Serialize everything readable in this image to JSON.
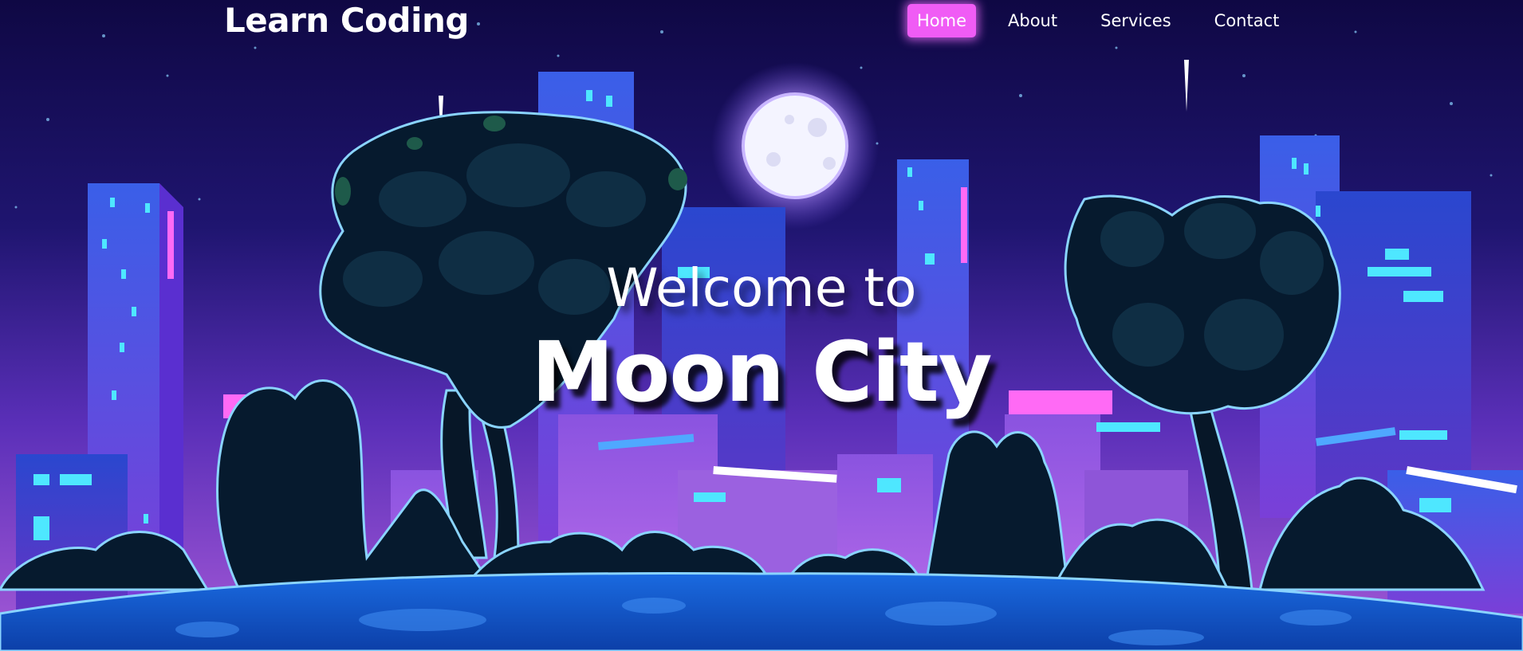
{
  "header": {
    "logo_text": "Learn Coding",
    "nav": [
      {
        "label": "Home",
        "active": true
      },
      {
        "label": "About",
        "active": false
      },
      {
        "label": "Services",
        "active": false
      },
      {
        "label": "Contact",
        "active": false
      }
    ]
  },
  "hero": {
    "subtitle": "Welcome to",
    "title": "Moon City"
  },
  "colors": {
    "sky_top": "#0f0844",
    "sky_bottom": "#5a2fb8",
    "accent_pink": "#f05cf5",
    "building_blue": "#3a5fe8",
    "ground": "#1560d8",
    "tree_dark": "#061a2e"
  }
}
